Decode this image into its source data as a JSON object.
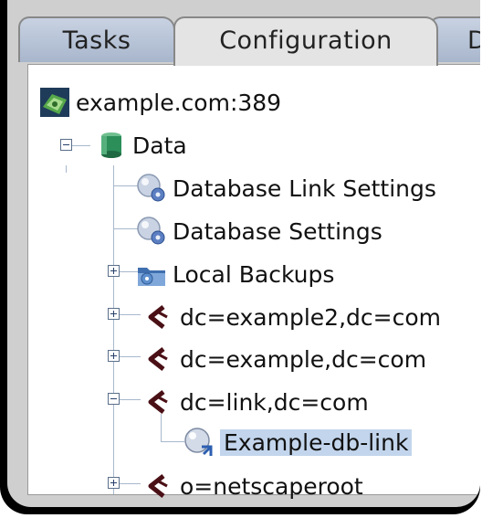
{
  "tabs": [
    {
      "label": "Tasks",
      "active": false
    },
    {
      "label": "Configuration",
      "active": true
    },
    {
      "label": "Di",
      "active": false
    }
  ],
  "tree": {
    "root": {
      "label": "example.com:389",
      "icon": "server-icon"
    },
    "data": {
      "label": "Data",
      "icon": "database-icon",
      "expanded": true
    },
    "items": [
      {
        "label": "Database Link Settings",
        "icon": "settings-gear-icon"
      },
      {
        "label": "Database Settings",
        "icon": "settings-gear-icon"
      },
      {
        "label": "Local Backups",
        "icon": "backup-folder-icon",
        "expanded": false
      },
      {
        "label": "dc=example2,dc=com",
        "icon": "suffix-icon",
        "expanded": false
      },
      {
        "label": "dc=example,dc=com",
        "icon": "suffix-icon",
        "expanded": false
      },
      {
        "label": "dc=link,dc=com",
        "icon": "suffix-icon",
        "expanded": true
      },
      {
        "label": "Example-db-link",
        "icon": "db-link-icon",
        "selected": true
      },
      {
        "label": "o=netscaperoot",
        "icon": "suffix-icon",
        "expanded": false
      }
    ]
  },
  "colors": {
    "selection": "#c2d5ec",
    "tab_inactive": "#b4c0d4",
    "panel": "#cfcfcf"
  }
}
